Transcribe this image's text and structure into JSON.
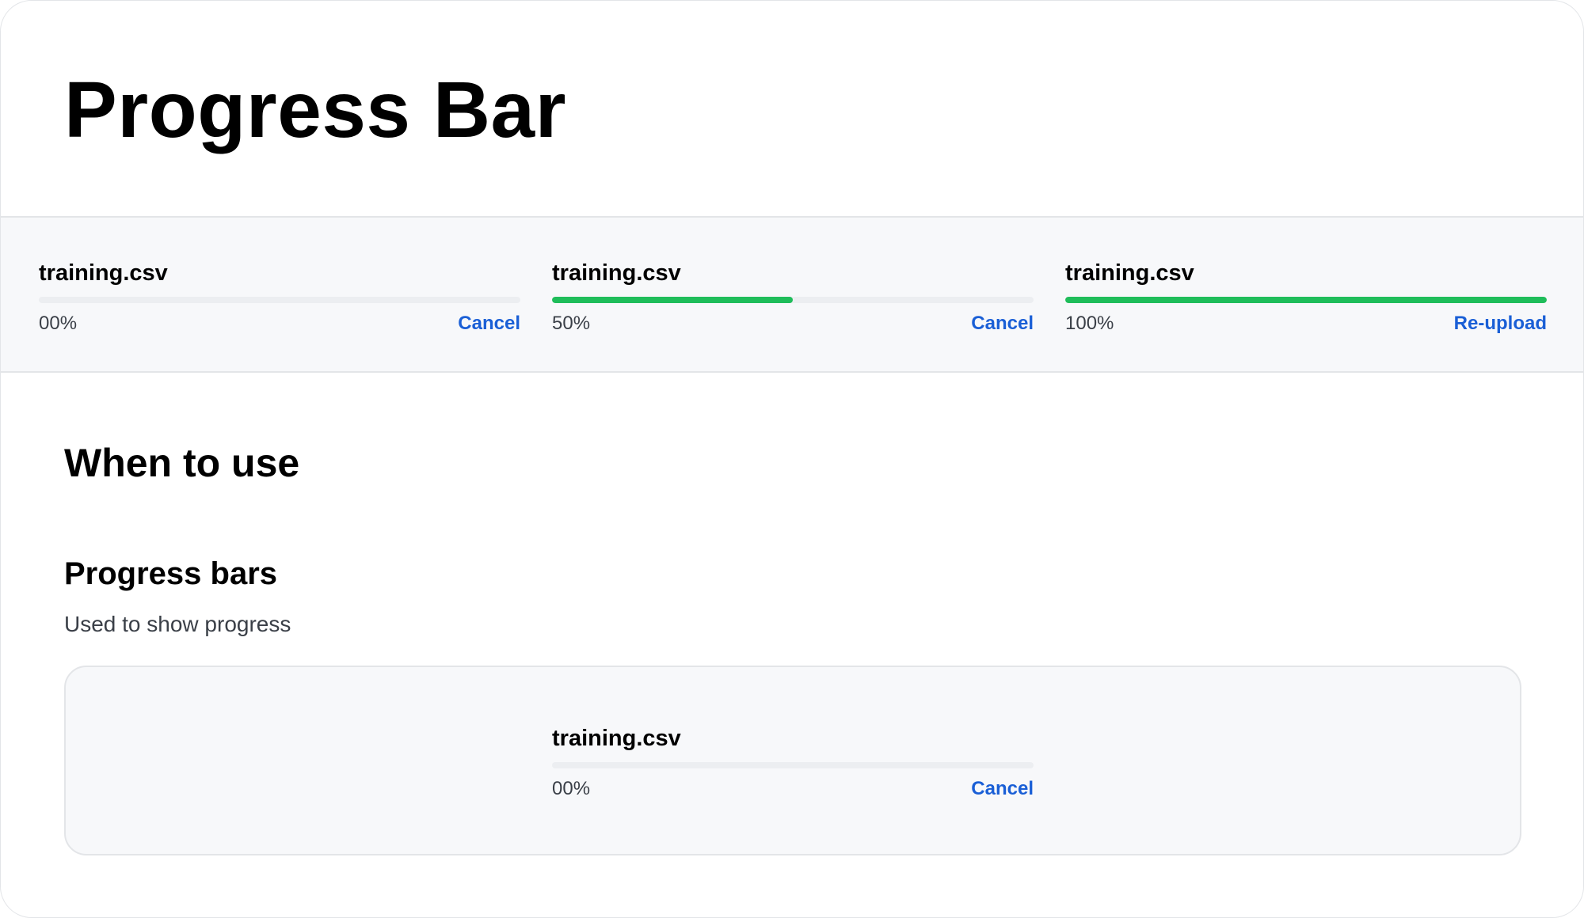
{
  "page": {
    "title": "Progress Bar"
  },
  "demo_items": [
    {
      "file_name": "training.csv",
      "percent_label": "00%",
      "progress": 0.0,
      "action_label": "Cancel"
    },
    {
      "file_name": "training.csv",
      "percent_label": "50%",
      "progress": 0.5,
      "action_label": "Cancel"
    },
    {
      "file_name": "training.csv",
      "percent_label": "100%",
      "progress": 1.0,
      "action_label": "Re-upload"
    }
  ],
  "when_to_use": {
    "heading": "When to use",
    "subheading": "Progress bars",
    "description": "Used to show progress",
    "example": {
      "file_name": "training.csv",
      "percent_label": "00%",
      "progress": 0.0,
      "action_label": "Cancel"
    }
  },
  "colors": {
    "progress_fill": "#1fbd5a",
    "track": "#eceef1",
    "link": "#1a5fd6",
    "band_background": "#f7f8fa",
    "border": "#e3e5e8"
  }
}
